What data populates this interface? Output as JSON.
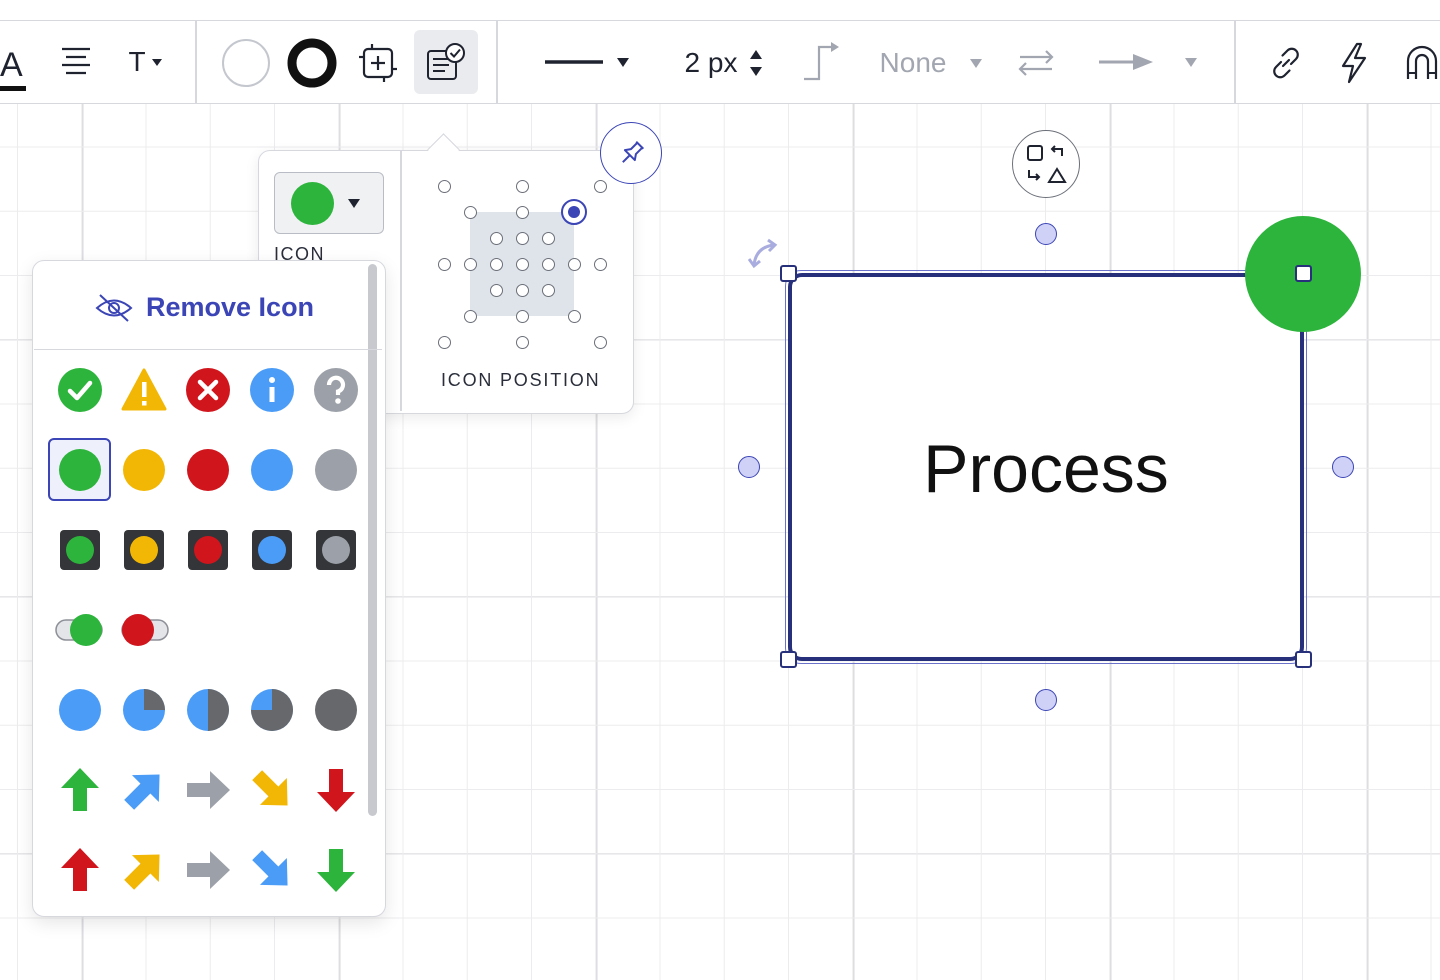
{
  "toolbar": {
    "font_color_label": "A",
    "text_label": "T",
    "line_width": "2 px",
    "endpoint_none": "None"
  },
  "icon_popup": {
    "icon_label": "ICON",
    "position_label": "ICON POSITION",
    "selected_icon_color": "#2db43c"
  },
  "icon_library": {
    "remove_label": "Remove Icon",
    "accent": "#3b45b5"
  },
  "canvas": {
    "shape_text": "Process",
    "status_color": "#2db43c"
  }
}
